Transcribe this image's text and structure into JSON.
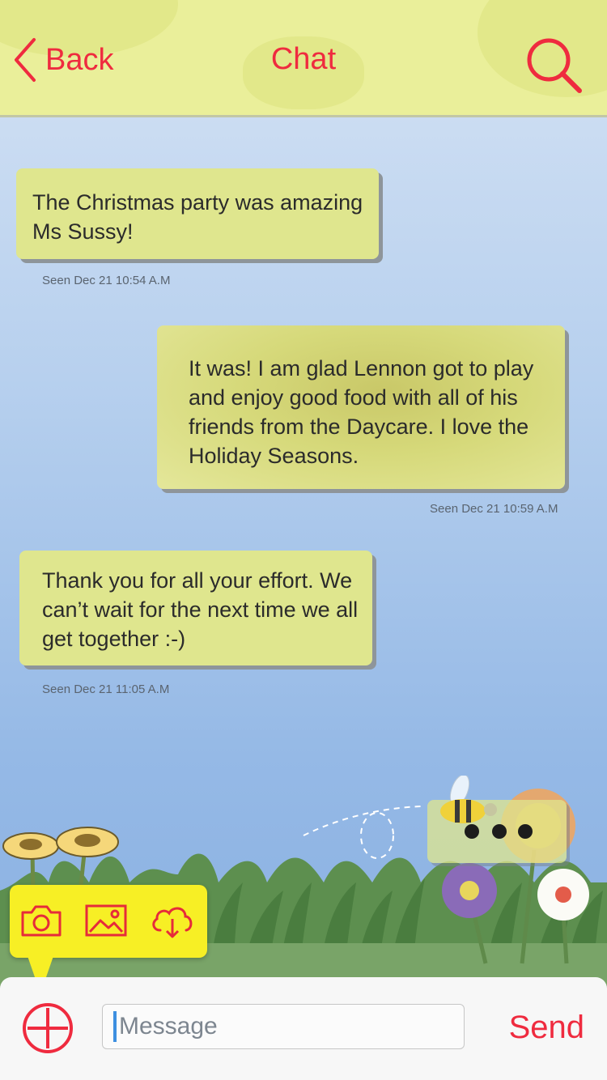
{
  "header": {
    "back_label": "Back",
    "title": "Chat",
    "back_icon": "chevron-left-icon",
    "search_icon": "search-icon"
  },
  "messages": [
    {
      "text": "The Christmas party was amazing Ms Sussy!",
      "seen": "Seen Dec 21 10:54 A.M",
      "sender": "other"
    },
    {
      "text": "It was! I am glad Lennon got to play and enjoy good food with all of his friends from the Daycare. I love the Holiday Seasons.",
      "seen": "Seen Dec 21 10:59 A.M",
      "sender": "me"
    },
    {
      "text": "Thank you for all your effort. We can’t wait for the next time we all get together :-)",
      "seen": "Seen Dec 21 11:05 A.M",
      "sender": "other"
    }
  ],
  "attach_menu": {
    "items": [
      "camera-icon",
      "image-icon",
      "cloud-download-icon"
    ]
  },
  "composer": {
    "placeholder": "Message",
    "value": "",
    "send_label": "Send",
    "add_icon": "plus-circle-icon"
  },
  "colors": {
    "accent": "#ef2b3f",
    "header_bg": "#eaef9a",
    "bubble_bg": "#dfe68e",
    "popup_bg": "#f7ef25",
    "caret": "#3d8fe0"
  }
}
